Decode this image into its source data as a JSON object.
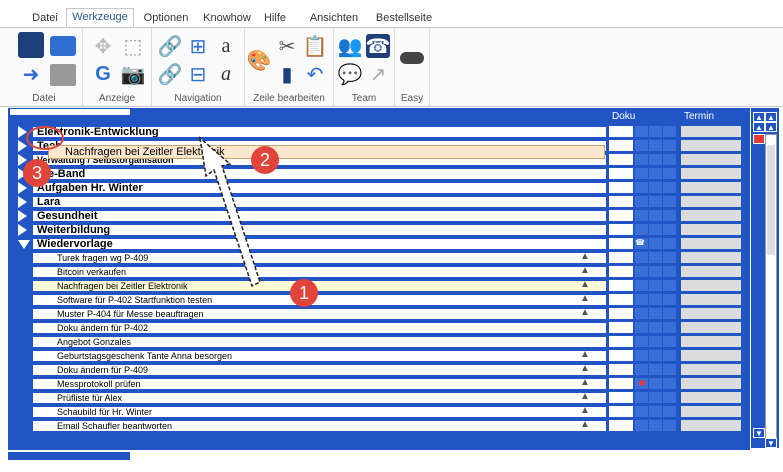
{
  "tabs": [
    "Datei",
    "Werkzeuge",
    "Optionen",
    "Knowhow",
    "Hilfe",
    "Ansichten",
    "Bestellseite"
  ],
  "groups": [
    "Datei",
    "Anzeige",
    "Navigation",
    "Zeile bearbeiten",
    "Team",
    "Easy"
  ],
  "columns": {
    "doku": "Doku",
    "termin": "Termin"
  },
  "top_rows": [
    "Elektronik-Entwicklung",
    "Tech",
    "Verwaltung / Selbstorganisation",
    "Kie-Band",
    "Aufgaben Hr. Winter",
    "Lara",
    "Gesundheit",
    "Weiterbildung",
    "Wiedervorlage"
  ],
  "children": [
    "Turek fragen wg P-409",
    "Bitcoin verkaufen",
    "Nachfragen bei Zeitler Elektronik",
    "Software für P-402 Startfunktion testen",
    "Muster P-404 für Messe beauftragen",
    "Doku ändern für P-402",
    "Angebot Gonzales",
    "Geburtstagsgeschenk Tante Anna besorgen",
    "Doku ändern für P-409",
    "Messprotokoll prüfen",
    "Prüfliste für Alex",
    "Schaubild für Hr. Winter",
    "Email Schaufler beantworten"
  ],
  "drag_label": "Nachfragen bei Zeitler Elektronik",
  "callouts": [
    "1",
    "2",
    "3"
  ],
  "ellipsis": "...",
  "plus": "+"
}
